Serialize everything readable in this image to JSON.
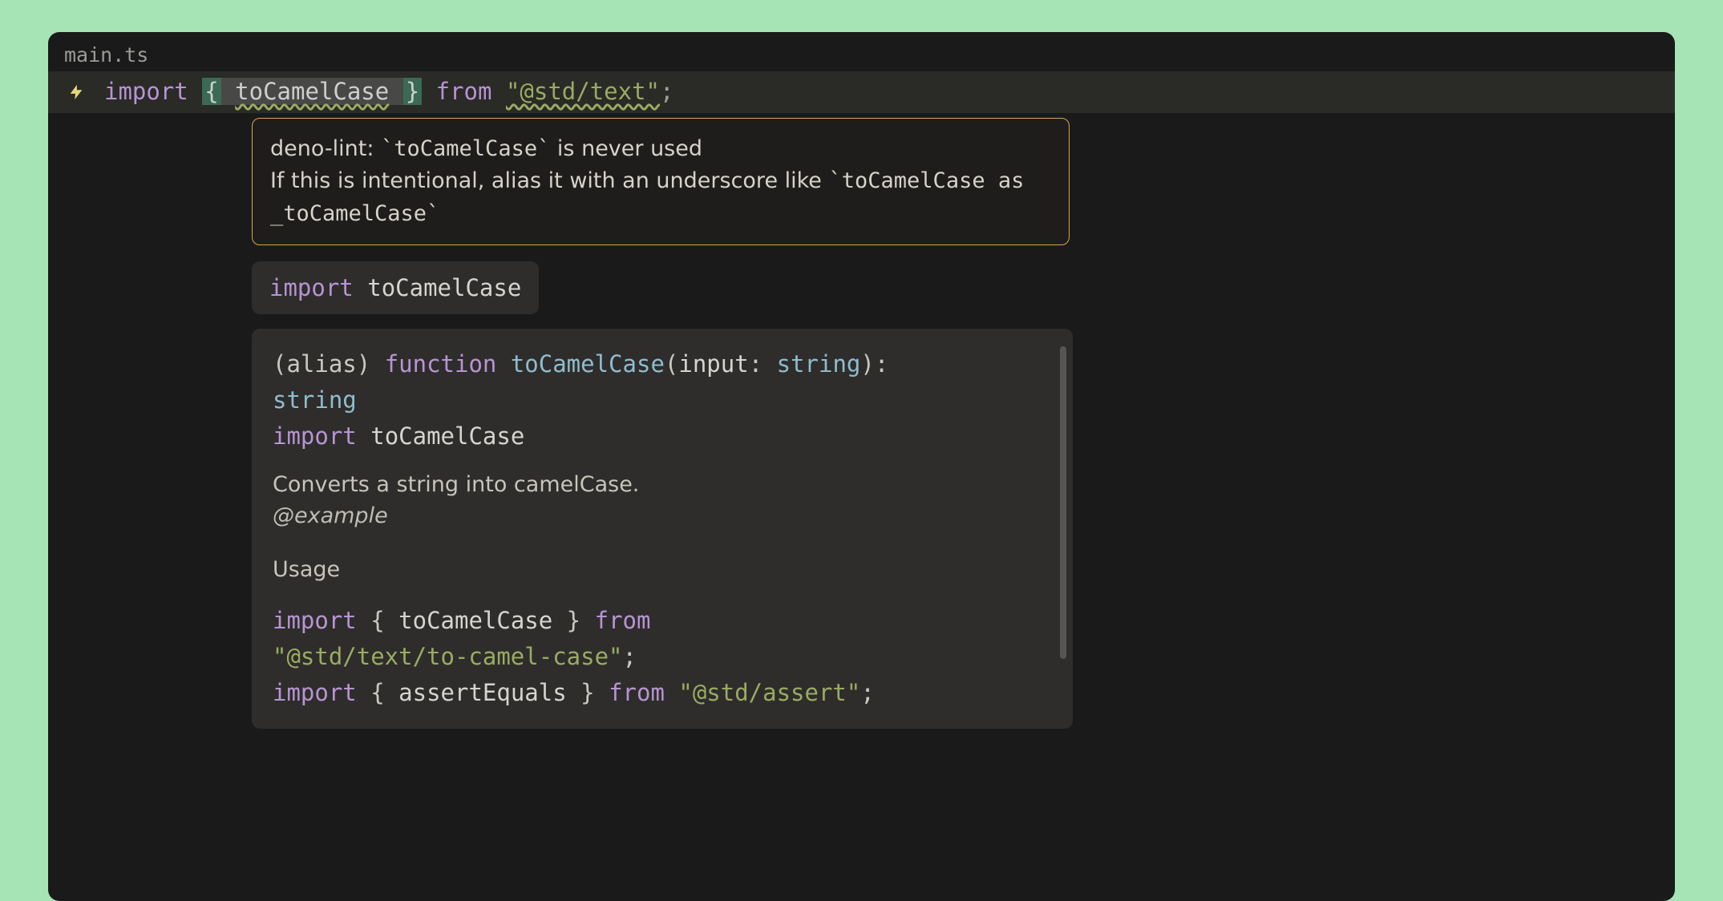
{
  "tab": {
    "filename": "main.ts"
  },
  "code": {
    "kw_import": "import",
    "brace_open": "{",
    "sel_pre_space": " ",
    "sel_name": "toCamelCase",
    "sel_post_space": " ",
    "brace_close": "}",
    "kw_from": "from",
    "string_val": "\"@std/text\"",
    "semicolon": ";"
  },
  "lint": {
    "line1_prefix": "deno-lint: ",
    "line1_code": "`toCamelCase`",
    "line1_suffix": " is never used",
    "line2_prefix": "If this is intentional, alias it with an underscore like ",
    "line2_code": "`toCamelCase as _toCamelCase`"
  },
  "suggestion": {
    "kw": "import",
    "name": "toCamelCase"
  },
  "doc": {
    "sig_alias": "(alias)",
    "sig_fn": "function",
    "sig_name": "toCamelCase",
    "sig_open": "(",
    "sig_param": "input",
    "sig_colon": ": ",
    "sig_type": "string",
    "sig_close": "): ",
    "sig_ret": "string",
    "imp_kw": "import",
    "imp_name": "toCamelCase",
    "prose": "Converts a string into camelCase.",
    "tag": "@example",
    "usage_heading": "Usage",
    "ex1_kw_import": "import",
    "ex1_brace_open": " { ",
    "ex1_name": "toCamelCase",
    "ex1_brace_close": " } ",
    "ex1_kw_from": "from",
    "ex1_str": "\"@std/text/to-camel-case\"",
    "ex1_semi": ";",
    "ex2_kw_import": "import",
    "ex2_brace_open": " { ",
    "ex2_name": "assertEquals",
    "ex2_brace_close": " } ",
    "ex2_kw_from": "from",
    "ex2_str": "\"@std/assert\"",
    "ex2_semi": ";"
  }
}
